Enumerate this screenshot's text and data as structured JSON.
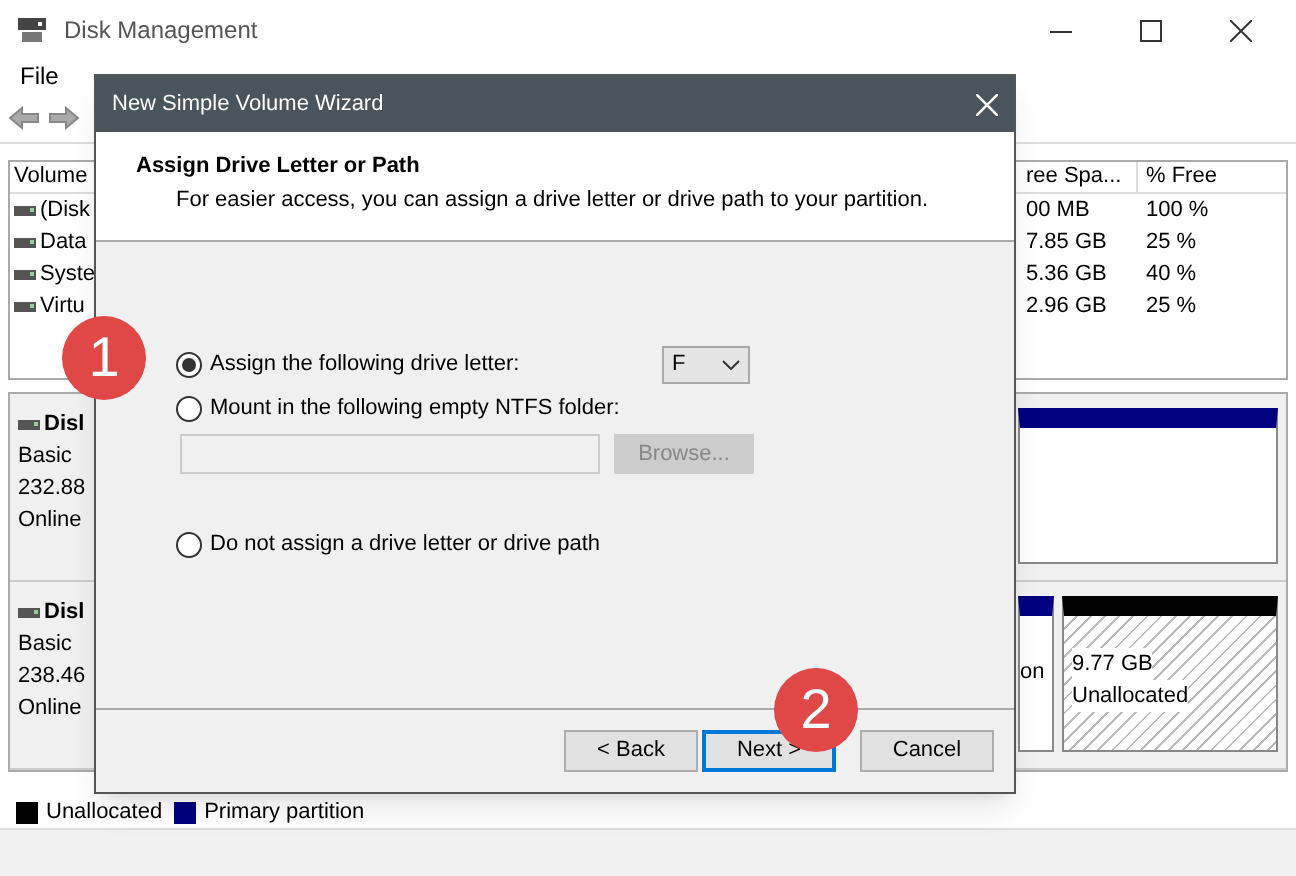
{
  "window": {
    "title": "Disk Management"
  },
  "menu": [
    "File"
  ],
  "volume_table": {
    "columns": [
      "Volume",
      "ree Spa...",
      "% Free"
    ],
    "rows": [
      {
        "volume": "(Disk",
        "free_space": "00 MB",
        "percent_free": "100 %"
      },
      {
        "volume": "Data",
        "free_space": "7.85 GB",
        "percent_free": "25 %"
      },
      {
        "volume": "Syste",
        "free_space": "5.36 GB",
        "percent_free": "40 %"
      },
      {
        "volume": "Virtu",
        "free_space": "2.96 GB",
        "percent_free": "25 %"
      }
    ]
  },
  "disks": [
    {
      "name": "Disl",
      "type": "Basic",
      "size": "232.88",
      "status": "Online",
      "partitions": [
        {
          "kind": "primary"
        }
      ]
    },
    {
      "name": "Disl",
      "type": "Basic",
      "size": "238.46",
      "status": "Online",
      "partitions": [
        {
          "kind": "primary",
          "lines": [
            "on"
          ]
        },
        {
          "kind": "unallocated",
          "lines": [
            "9.77 GB",
            "Unallocated"
          ]
        }
      ]
    }
  ],
  "legend": [
    {
      "label": "Unallocated",
      "color": "#000000"
    },
    {
      "label": "Primary partition",
      "color": "#000080"
    }
  ],
  "dialog": {
    "title": "New Simple Volume Wizard",
    "heading": "Assign Drive Letter or Path",
    "subtitle": "For easier access, you can assign a drive letter or drive path to your partition.",
    "options": [
      {
        "kind": "letter",
        "label": "Assign the following drive letter:",
        "selected": true
      },
      {
        "kind": "folder",
        "label": "Mount in the following empty NTFS folder:",
        "selected": false
      },
      {
        "kind": "none",
        "label": "Do not assign a drive letter or drive path",
        "selected": false
      }
    ],
    "drive_letter": "F",
    "browse_button": {
      "label": "Browse...",
      "disabled": true
    },
    "buttons": [
      {
        "label": "< Back",
        "default": false
      },
      {
        "label": "Next >",
        "default": true
      },
      {
        "label": "Cancel",
        "default": false
      }
    ]
  },
  "callouts": [
    "1",
    "2"
  ]
}
